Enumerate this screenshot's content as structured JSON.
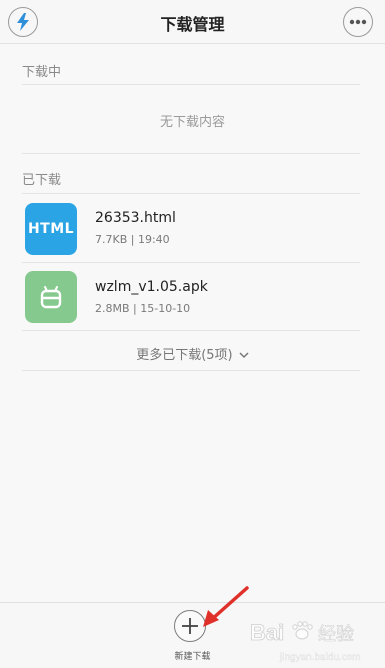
{
  "header": {
    "title": "下载管理",
    "left_icon": "lightning-icon",
    "right_icon": "more-dots-icon"
  },
  "downloading": {
    "section_label": "下载中",
    "empty_text": "无下载内容"
  },
  "downloaded": {
    "section_label": "已下载",
    "items": [
      {
        "icon": "html-file-icon",
        "icon_text": "HTML",
        "icon_color": "#2aa4e4",
        "name": "26353.html",
        "meta": "7.7KB | 19:40"
      },
      {
        "icon": "android-apk-icon",
        "icon_color": "#86c98e",
        "name": "wzlm_v1.05.apk",
        "meta": "2.8MB | 15-10-10"
      }
    ],
    "more_label": "更多已下载(5项)"
  },
  "bottom": {
    "add_label": "新建下载"
  },
  "colors": {
    "background": "#f8f8f8",
    "annotation_arrow": "#e0302a"
  },
  "watermark": {
    "text": "Baidu经验",
    "url": "jingyan.baidu.com"
  }
}
